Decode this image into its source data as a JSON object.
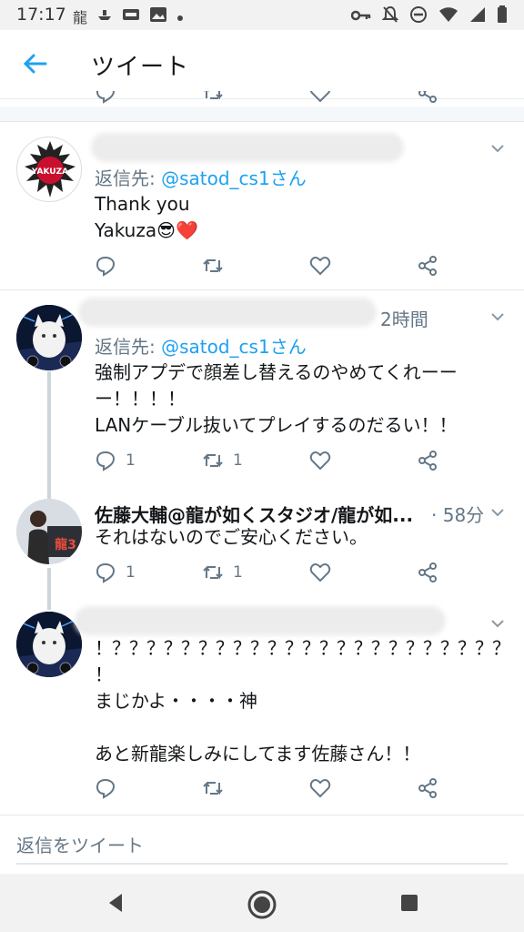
{
  "status_bar": {
    "time": "17:17",
    "notification_icons": [
      "dragon-notification-icon",
      "ship-notification-icon",
      "news-notification-icon",
      "photo-notification-icon",
      "dot-icon"
    ],
    "right_icons": [
      "key-icon",
      "mute-icon",
      "dnd-icon",
      "wifi-icon",
      "signal-icon",
      "battery-icon"
    ]
  },
  "header": {
    "title": "ツイート"
  },
  "tweets": [
    {
      "reply_to_prefix": "返信先: ",
      "reply_to_handle": "@satod_cs1さん",
      "lines": [
        "Thank you",
        "Yakuza😎❤️"
      ],
      "counts": {
        "reply": "",
        "retweet": ""
      }
    },
    {
      "time": "2時間",
      "reply_to_prefix": "返信先: ",
      "reply_to_handle": "@satod_cs1さん",
      "lines": [
        "強制アプデで顔差し替えるのやめてくれーー",
        "ー！！！！",
        "LANケーブル抜いてプレイするのだるい！！"
      ],
      "counts": {
        "reply": "1",
        "retweet": "1"
      }
    },
    {
      "name": "佐藤大輔@龍が如くスタジオ/龍が如...",
      "time": "· 58分",
      "lines": [
        "それはないのでご安心ください。"
      ],
      "counts": {
        "reply": "1",
        "retweet": "1"
      }
    },
    {
      "lines": [
        "！？？？？？？？？？？？？？？？？？？？？？？？",
        "！",
        "まじかよ・・・・神",
        "",
        "あと新龍楽しみにしてます佐藤さん！！"
      ],
      "counts": {
        "reply": "",
        "retweet": ""
      }
    }
  ],
  "reply_box": {
    "placeholder": "返信をツイート"
  },
  "colors": {
    "accent": "#1da1f2",
    "secondary_text": "#657786",
    "like_red": "#e0245e"
  }
}
